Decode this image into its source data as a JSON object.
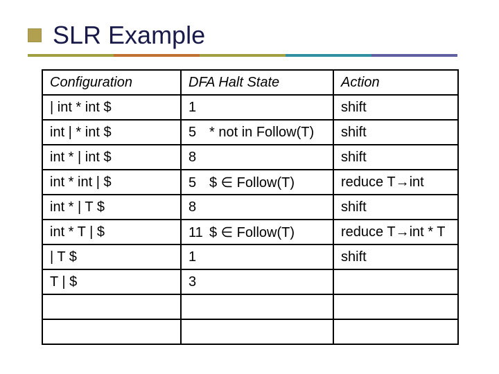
{
  "title": "SLR Example",
  "table": {
    "headers": [
      "Configuration",
      "DFA Halt State",
      "Action"
    ],
    "rows": [
      {
        "config": "| int * int $",
        "state": "1",
        "note": "",
        "action": "shift"
      },
      {
        "config": "int | * int $",
        "state": "5",
        "note": "* not in Follow(T)",
        "action": "shift"
      },
      {
        "config": "int * | int $",
        "state": "8",
        "note": "",
        "action": "shift"
      },
      {
        "config": "int * int | $",
        "state": "5",
        "note": "$ ∈ Follow(T)",
        "action": "reduce T→int"
      },
      {
        "config": "int * | T $",
        "state": "8",
        "note": "",
        "action": "shift"
      },
      {
        "config": "int * T | $",
        "state": "11",
        "note": "$ ∈ Follow(T)",
        "action": "reduce T→int * T"
      },
      {
        "config": "| T $",
        "state": "1",
        "note": "",
        "action": "shift"
      },
      {
        "config": "T | $",
        "state": "3",
        "note": "",
        "action": ""
      },
      {
        "config": "",
        "state": "",
        "note": "",
        "action": ""
      },
      {
        "config": "",
        "state": "",
        "note": "",
        "action": ""
      }
    ]
  }
}
